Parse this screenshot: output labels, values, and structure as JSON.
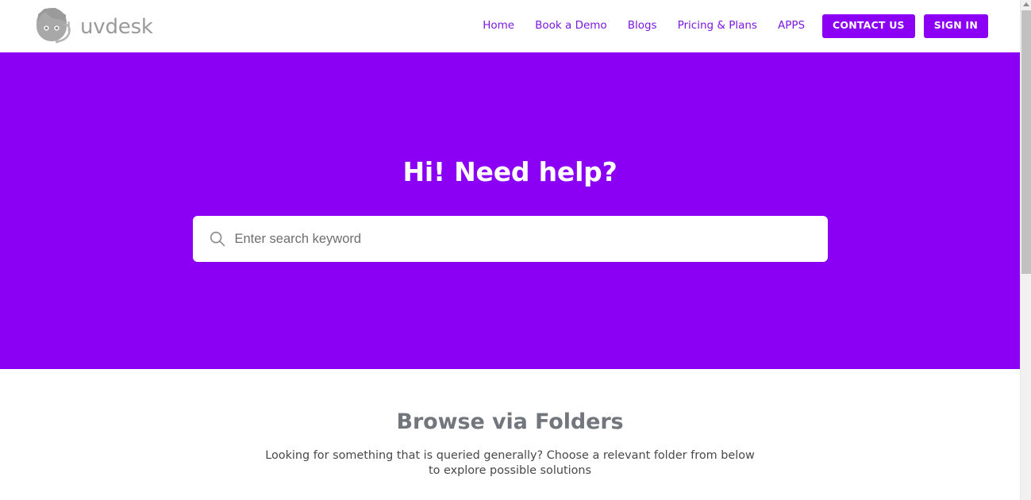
{
  "brand": {
    "name": "uvdesk",
    "logo_icon": "headset-avatar-icon"
  },
  "nav": {
    "links": [
      {
        "label": "Home"
      },
      {
        "label": "Book a Demo"
      },
      {
        "label": "Blogs"
      },
      {
        "label": "Pricing & Plans"
      },
      {
        "label": "APPS"
      }
    ],
    "buttons": [
      {
        "label": "CONTACT US"
      },
      {
        "label": "SIGN IN"
      }
    ]
  },
  "hero": {
    "title": "Hi! Need help?",
    "search": {
      "placeholder": "Enter search keyword",
      "value": "",
      "icon": "search-icon"
    }
  },
  "folders": {
    "title": "Browse via Folders",
    "subtitle": "Looking for something that is queried generally? Choose a relevant folder from below to explore possible solutions"
  },
  "colors": {
    "brand_purple": "#8b00f5",
    "nav_link": "#7a18e0",
    "heading_gray": "#72767d",
    "body_gray": "#484848",
    "logo_gray": "#9a9a9a",
    "scrollbar_thumb": "#c1c1c1"
  }
}
